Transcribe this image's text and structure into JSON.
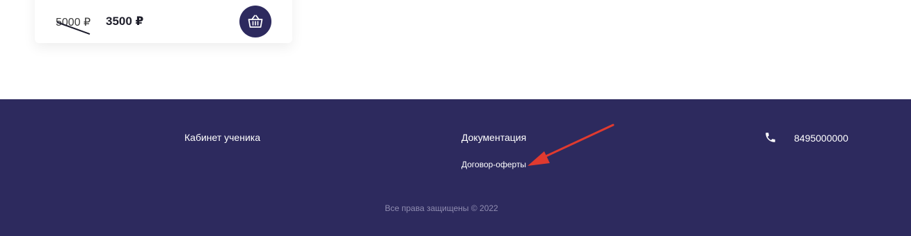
{
  "product_card": {
    "old_price": "5000 ₽",
    "new_price": "3500 ₽",
    "cart_icon": "basket-icon"
  },
  "footer": {
    "student_cabinet_link": "Кабинет ученика",
    "documents_heading": "Документация",
    "offer_contract_link": "Договор-оферты",
    "phone_icon": "phone-icon",
    "phone_number": "8495000000",
    "copyright": "Все права защищены © 2022"
  },
  "colors": {
    "brand_navy": "#2d2a5e",
    "annotation_red": "#e03a2f",
    "muted_text": "#8f8cb0"
  }
}
